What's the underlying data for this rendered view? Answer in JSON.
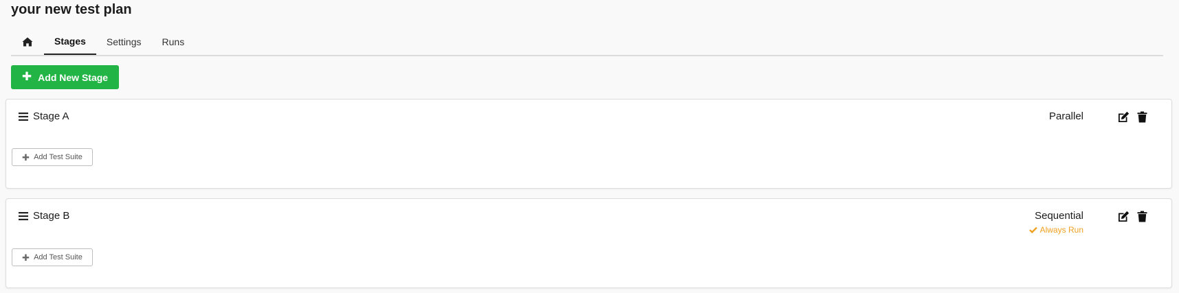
{
  "page": {
    "title": "your new test plan"
  },
  "tabs": [
    {
      "label": "",
      "icon": "home-icon"
    },
    {
      "label": "Stages",
      "active": true
    },
    {
      "label": "Settings"
    },
    {
      "label": "Runs"
    }
  ],
  "toolbar": {
    "add_stage_label": "Add New Stage",
    "add_stage_color": "#22b445"
  },
  "stages": [
    {
      "name": "Stage A",
      "mode": "Parallel",
      "always_run": false,
      "add_suite_label": "Add Test Suite"
    },
    {
      "name": "Stage B",
      "mode": "Sequential",
      "always_run": true,
      "always_run_label": "Always Run",
      "always_run_color": "#f0a020",
      "add_suite_label": "Add Test Suite"
    }
  ],
  "icons": [
    "home-icon",
    "plus-icon",
    "drag-handle-icon",
    "edit-icon",
    "trash-icon",
    "check-icon"
  ]
}
